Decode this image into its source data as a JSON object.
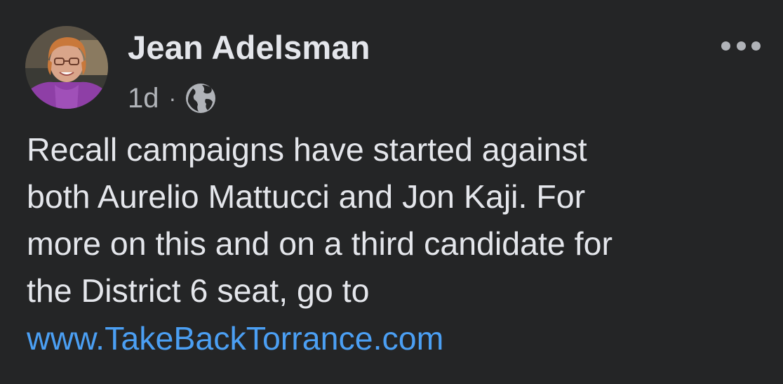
{
  "post": {
    "author_name": "Jean Adelsman",
    "timestamp": "1d",
    "separator": "·",
    "privacy_icon": "globe-icon",
    "more_icon": "more-options-icon",
    "body": "Recall campaigns have started against\nboth Aurelio Mattucci and Jon Kaji. For\nmore on this and on a third candidate for\nthe District 6 seat, go to",
    "link_text": "www.TakeBackTorrance.com"
  },
  "colors": {
    "background": "#242526",
    "primary_text": "#e4e6eb",
    "secondary_text": "#b0b3b8",
    "link": "#4b9ff3"
  }
}
